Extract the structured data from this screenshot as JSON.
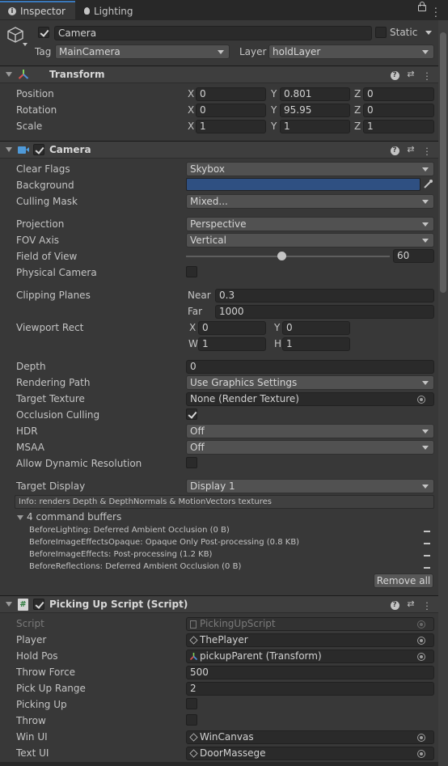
{
  "tabs": {
    "inspector": "Inspector",
    "lighting": "Lighting"
  },
  "gameobject": {
    "name": "Camera",
    "static_label": "Static",
    "tag_label": "Tag",
    "tag_value": "MainCamera",
    "layer_label": "Layer",
    "layer_value": "holdLayer"
  },
  "transform": {
    "title": "Transform",
    "position": {
      "label": "Position",
      "x": "0",
      "y": "0.801",
      "z": "0"
    },
    "rotation": {
      "label": "Rotation",
      "x": "0",
      "y": "95.95",
      "z": "0"
    },
    "scale": {
      "label": "Scale",
      "x": "1",
      "y": "1",
      "z": "1"
    },
    "axis_x": "X",
    "axis_y": "Y",
    "axis_z": "Z"
  },
  "camera": {
    "title": "Camera",
    "clear_flags": {
      "label": "Clear Flags",
      "value": "Skybox"
    },
    "background": {
      "label": "Background",
      "color": "#2f5082"
    },
    "culling_mask": {
      "label": "Culling Mask",
      "value": "Mixed..."
    },
    "projection": {
      "label": "Projection",
      "value": "Perspective"
    },
    "fov_axis": {
      "label": "FOV Axis",
      "value": "Vertical"
    },
    "fov": {
      "label": "Field of View",
      "value": "60",
      "fraction": 0.47
    },
    "physical": {
      "label": "Physical Camera"
    },
    "clipping": {
      "label": "Clipping Planes",
      "near_label": "Near",
      "near": "0.3",
      "far_label": "Far",
      "far": "1000"
    },
    "viewport": {
      "label": "Viewport Rect",
      "x_label": "X",
      "x": "0",
      "y_label": "Y",
      "y": "0",
      "w_label": "W",
      "w": "1",
      "h_label": "H",
      "h": "1"
    },
    "depth": {
      "label": "Depth",
      "value": "0"
    },
    "rendering_path": {
      "label": "Rendering Path",
      "value": "Use Graphics Settings"
    },
    "target_texture": {
      "label": "Target Texture",
      "value": "None (Render Texture)"
    },
    "occlusion": {
      "label": "Occlusion Culling"
    },
    "hdr": {
      "label": "HDR",
      "value": "Off"
    },
    "msaa": {
      "label": "MSAA",
      "value": "Off"
    },
    "dynres": {
      "label": "Allow Dynamic Resolution"
    },
    "target_display": {
      "label": "Target Display",
      "value": "Display 1"
    },
    "info": "Info: renders Depth & DepthNormals & MotionVectors textures",
    "buffers_title": "4 command buffers",
    "buffers": [
      "BeforeLighting: Deferred Ambient Occlusion (0 B)",
      "BeforeImageEffectsOpaque: Opaque Only Post-processing (0.8 KB)",
      "BeforeImageEffects: Post-processing (1.2 KB)",
      "BeforeReflections: Deferred Ambient Occlusion (0 B)"
    ],
    "remove_all": "Remove all"
  },
  "script": {
    "title": "Picking Up Script (Script)",
    "script": {
      "label": "Script",
      "value": "PickingUpScript"
    },
    "player": {
      "label": "Player",
      "value": "ThePlayer"
    },
    "hold_pos": {
      "label": "Hold Pos",
      "value": "pickupParent (Transform)"
    },
    "throw_force": {
      "label": "Throw Force",
      "value": "500"
    },
    "pick_up_range": {
      "label": "Pick Up Range",
      "value": "2"
    },
    "picking_up": {
      "label": "Picking Up"
    },
    "throw": {
      "label": "Throw"
    },
    "win_ui": {
      "label": "Win UI",
      "value": "WinCanvas"
    },
    "text_ui": {
      "label": "Text UI",
      "value": "DoorMassege"
    }
  },
  "colors": {
    "accent": "#3a79bb",
    "panel": "#383838",
    "field": "#2a2a2a"
  }
}
